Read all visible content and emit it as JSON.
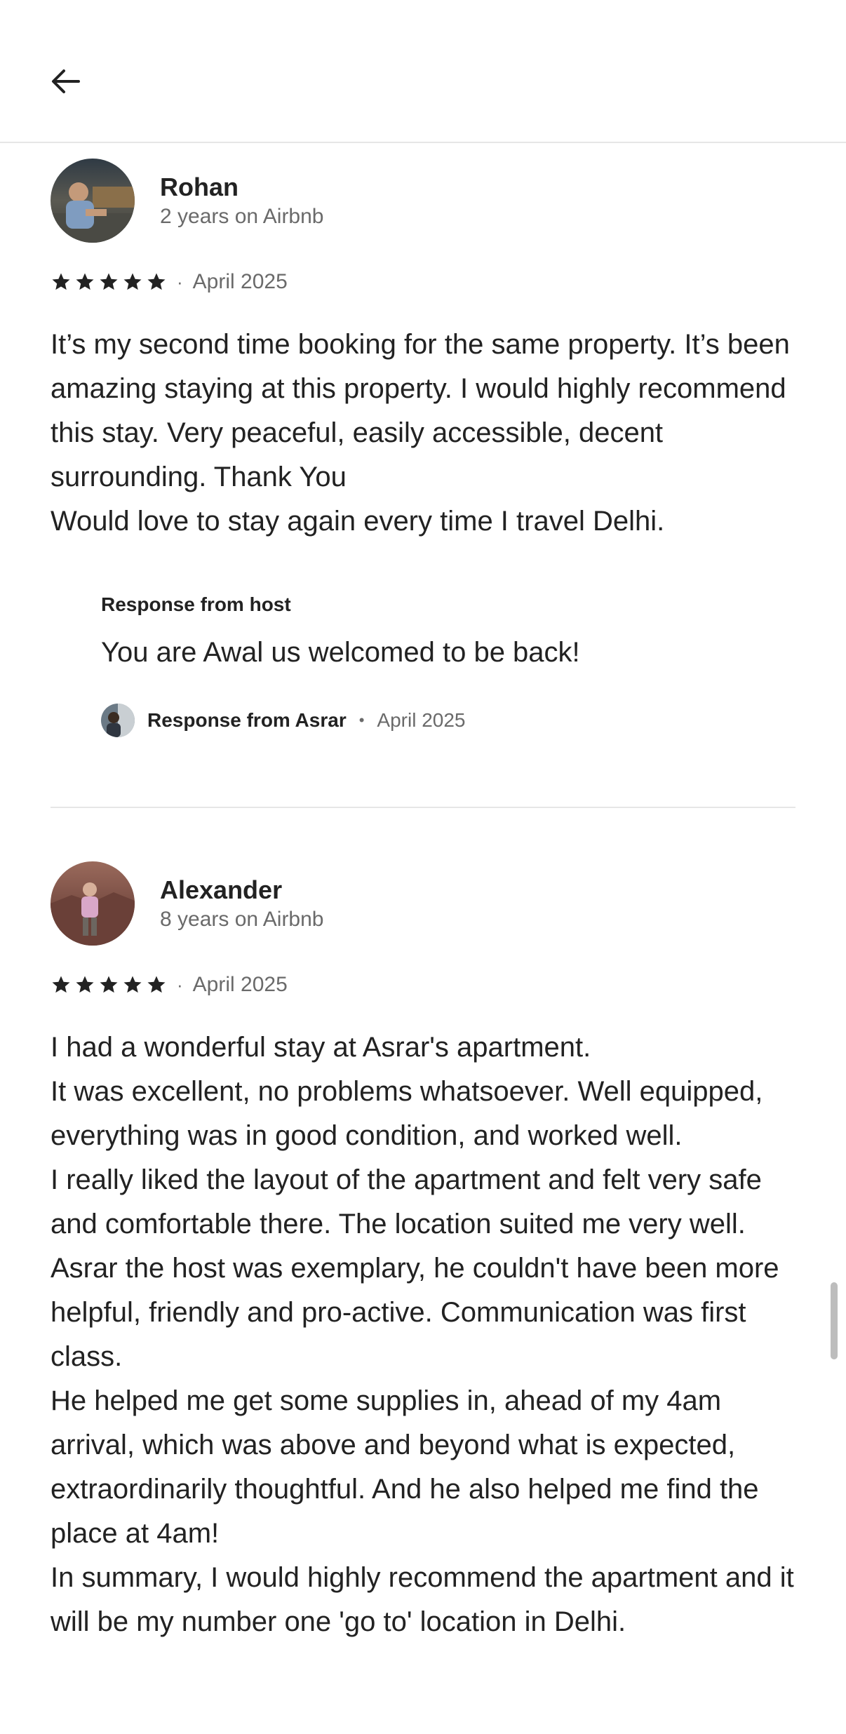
{
  "header": {
    "back_icon": "arrow-left-icon"
  },
  "reviews": [
    {
      "name": "Rohan",
      "tenure": "2 years on Airbnb",
      "rating": 5,
      "date": "April 2025",
      "text": "It’s my second time booking for the same property. It’s been amazing staying at this property. I would highly recommend this stay. Very peaceful, easily accessible, decent surrounding. Thank You\nWould love to stay again every time I travel Delhi.",
      "host_response": {
        "heading": "Response from host",
        "text": "You are Awal us welcomed to be back!",
        "responder": "Response from Asrar",
        "date": "April 2025"
      }
    },
    {
      "name": "Alexander",
      "tenure": "8 years on Airbnb",
      "rating": 5,
      "date": "April 2025",
      "text": "I had a wonderful stay at Asrar's apartment.\nIt was excellent, no problems whatsoever. Well equipped, everything was in good condition, and worked well.\nI really liked the layout of the apartment and felt very safe and comfortable there. The location suited me very well.\nAsrar the host was exemplary, he couldn't have been more helpful, friendly and pro-active. Communication was first class.\nHe helped me get some supplies in, ahead of my 4am arrival, which was above and beyond what is expected, extraordinarily thoughtful. And he also helped me find the place at 4am!\nIn summary, I would highly recommend the apartment and it will be my number one 'go to' location in Delhi."
    }
  ],
  "colors": {
    "text": "#222222",
    "muted": "#6a6a6a",
    "divider": "#e6e6e6",
    "star": "#222222"
  }
}
